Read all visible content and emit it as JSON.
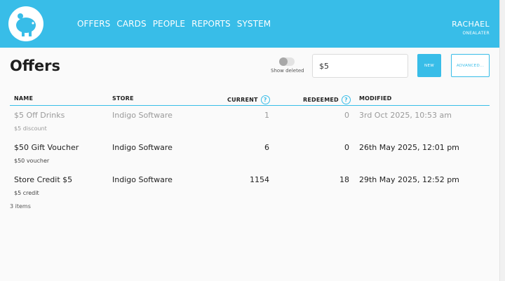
{
  "header": {
    "logo_icon": "piggy-bank-icon",
    "nav": [
      "OFFERS",
      "CARDS",
      "PEOPLE",
      "REPORTS",
      "SYSTEM"
    ],
    "user_name": "RACHAEL",
    "user_org": "ONEALATER"
  },
  "colors": {
    "accent": "#38bde8",
    "dim_text": "#9a9a9a"
  },
  "page": {
    "title": "Offers",
    "show_deleted_label": "Show deleted",
    "show_deleted_on": false,
    "search_value": "$5",
    "new_label": "NEW",
    "advanced_label": "ADVANCED..."
  },
  "table": {
    "columns": {
      "name": "NAME",
      "store": "STORE",
      "current": "CURRENT",
      "redeemed": "REDEEMED",
      "modified": "MODIFIED"
    },
    "rows": [
      {
        "name": "$5 Off Drinks",
        "sub": "$5 discount",
        "store": "Indigo Software",
        "current": "1",
        "redeemed": "0",
        "modified": "3rd Oct 2025, 10:53 am",
        "dim": true
      },
      {
        "name": "$50 Gift Voucher",
        "sub": "$50 voucher",
        "store": "Indigo Software",
        "current": "6",
        "redeemed": "0",
        "modified": "26th May 2025, 12:01 pm",
        "dim": false
      },
      {
        "name": "Store Credit $5",
        "sub": "$5 credit",
        "store": "Indigo Software",
        "current": "1154",
        "redeemed": "18",
        "modified": "29th May 2025, 12:52 pm",
        "dim": false
      }
    ],
    "count_label": "3 items"
  }
}
